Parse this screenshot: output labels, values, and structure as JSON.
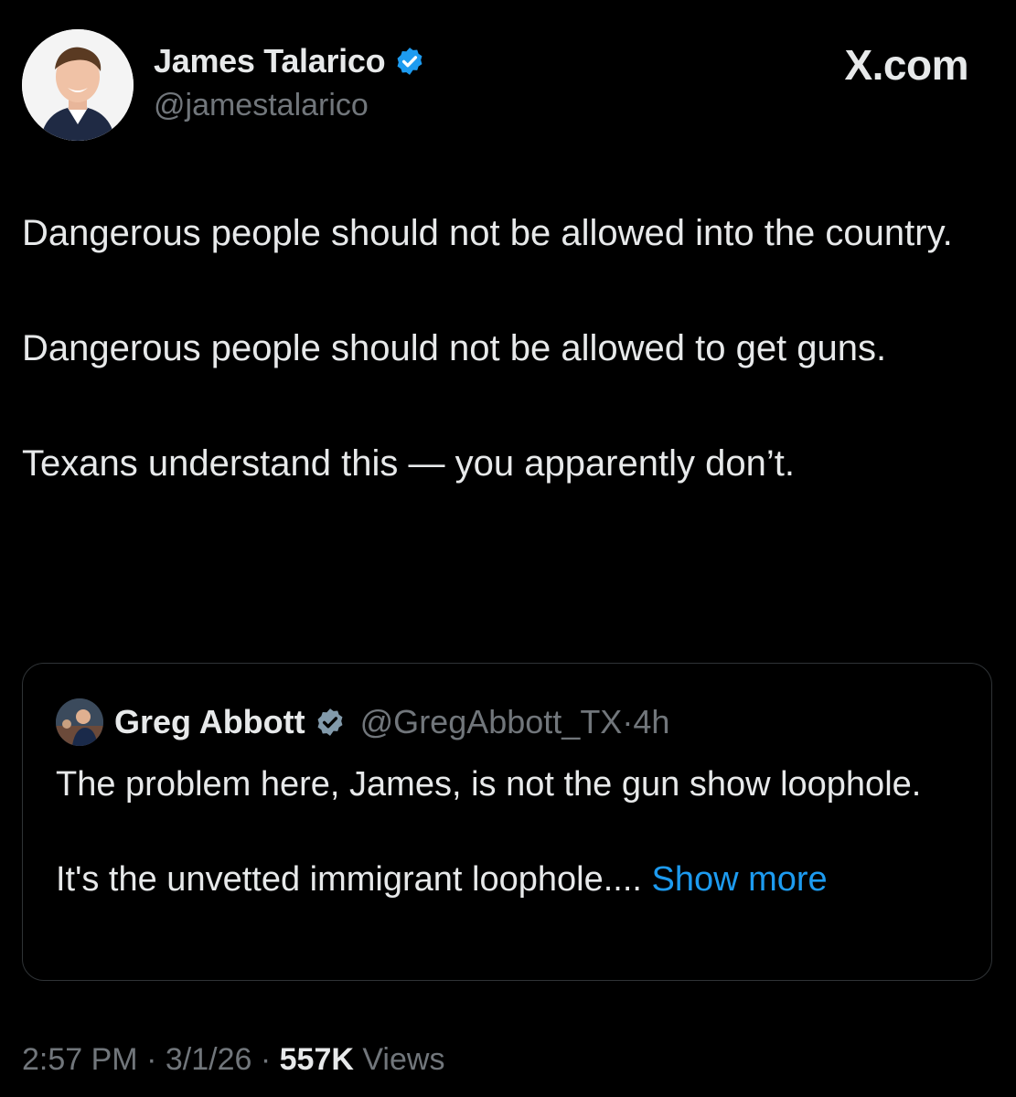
{
  "author": {
    "name": "James Talarico",
    "handle": "@jamestalarico",
    "verified_color": "#1d9bf0"
  },
  "brand": "X.com",
  "tweet": {
    "paragraphs": [
      "Dangerous people should not be allowed into the country.",
      "Dangerous people should not be allowed to get guns.",
      "Texans understand this — you apparently don’t."
    ]
  },
  "quoted": {
    "name": "Greg Abbott",
    "handle": "@GregAbbott_TX",
    "separator": "·",
    "time": "4h",
    "badge_color": "#829aab",
    "paragraphs": [
      "The problem here, James, is not the gun show loophole.",
      "It's the unvetted immigrant loophole...."
    ],
    "show_more": "Show more"
  },
  "meta": {
    "time": "2:57 PM",
    "sep1": "·",
    "date": "3/1/26",
    "sep2": "·",
    "views_count": "557K",
    "views_label": "Views"
  },
  "colors": {
    "background": "#000000",
    "text": "#e7e9ea",
    "secondary": "#71767b",
    "link": "#1d9bf0",
    "border": "#2f3336"
  }
}
